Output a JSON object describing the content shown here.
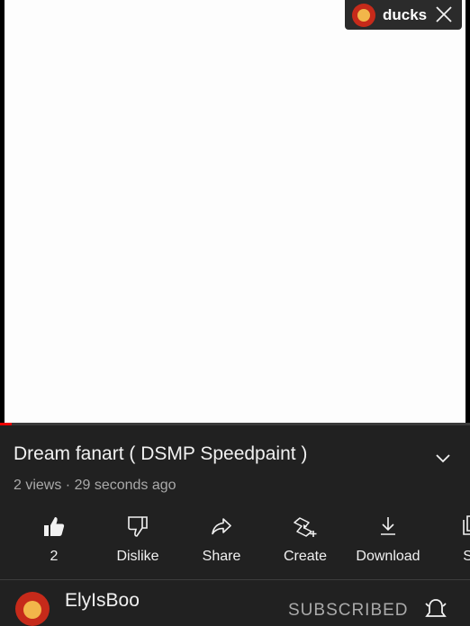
{
  "chip": {
    "avatar_icon": "channel-avatar-icon",
    "label": "ducks",
    "close_icon": "close-icon"
  },
  "video": {
    "progress_fraction": 0.025
  },
  "title": {
    "text": "Dream fanart ( DSMP Speedpaint )"
  },
  "meta": {
    "text": "2 views · 29 seconds ago"
  },
  "actions": [
    {
      "icon": "thumbs-up-icon",
      "label": "2"
    },
    {
      "icon": "thumbs-down-icon",
      "label": "Dislike"
    },
    {
      "icon": "share-icon",
      "label": "Share"
    },
    {
      "icon": "create-icon",
      "label": "Create"
    },
    {
      "icon": "download-icon",
      "label": "Download"
    },
    {
      "icon": "save-icon",
      "label": "Sa"
    }
  ],
  "channel": {
    "name": "ElyIsBoo",
    "subscribe_label": "SUBSCRIBED",
    "bell_icon": "bell-icon"
  },
  "colors": {
    "background": "#212121",
    "progress": "#ee0000",
    "text": "#f1f1f1",
    "muted": "#aaaaaa"
  }
}
